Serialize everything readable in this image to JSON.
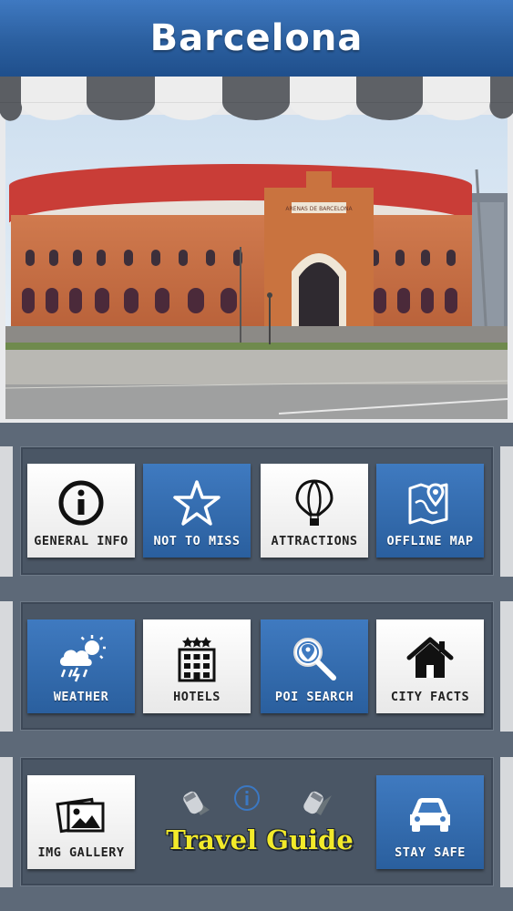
{
  "header": {
    "title": "Barcelona"
  },
  "photo": {
    "sign_text": "ARENAS DE BARCELONA"
  },
  "menu_rows": [
    [
      {
        "id": "general-info",
        "label": "GENERAL INFO",
        "style": "white",
        "icon": "info-icon"
      },
      {
        "id": "not-to-miss",
        "label": "NOT TO MISS",
        "style": "blue",
        "icon": "star-icon"
      },
      {
        "id": "attractions",
        "label": "ATTRACTIONS",
        "style": "white",
        "icon": "balloon-icon"
      },
      {
        "id": "offline-map",
        "label": "OFFLINE MAP",
        "style": "blue",
        "icon": "map-icon"
      }
    ],
    [
      {
        "id": "weather",
        "label": "WEATHER",
        "style": "blue",
        "icon": "weather-icon"
      },
      {
        "id": "hotels",
        "label": "HOTELS",
        "style": "white",
        "icon": "hotel-icon"
      },
      {
        "id": "poi-search",
        "label": "POI SEARCH",
        "style": "blue",
        "icon": "search-icon"
      },
      {
        "id": "city-facts",
        "label": "CITY FACTS",
        "style": "white",
        "icon": "home-icon"
      }
    ],
    [
      {
        "id": "img-gallery",
        "label": "IMG GALLERY",
        "style": "white",
        "icon": "gallery-icon"
      },
      {
        "id": "stay-safe",
        "label": "STAY SAFE",
        "style": "blue",
        "icon": "car-icon"
      }
    ]
  ],
  "footer": {
    "travel_guide": "Travel Guide"
  },
  "colors": {
    "header_blue": "#2b5f9f",
    "tile_blue": "#3f7ac0",
    "panel": "#4a5665",
    "guide_yellow": "#f2ea2a"
  }
}
